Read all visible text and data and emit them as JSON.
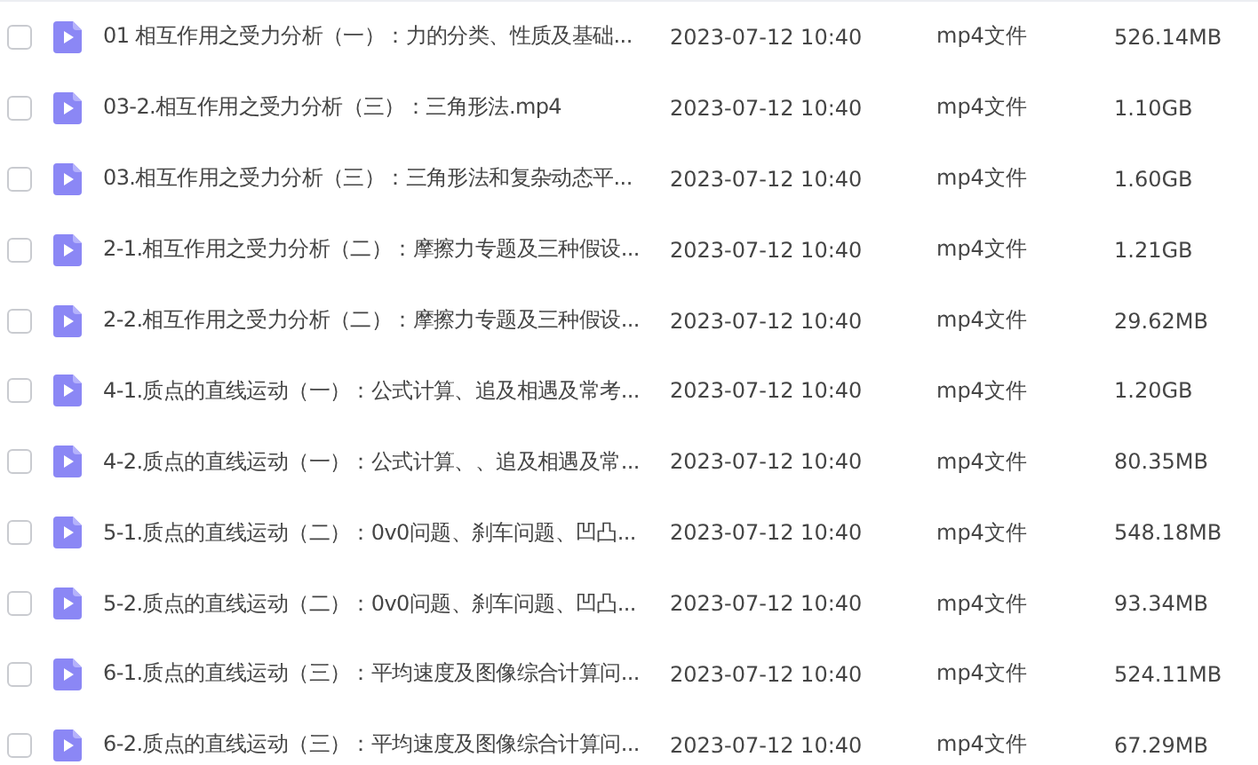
{
  "files": [
    {
      "checked": false,
      "name": "01 相互作用之受力分析（一）：力的分类、性质及基础...",
      "date": "2023-07-12 10:40",
      "type": "mp4文件",
      "size": "526.14MB"
    },
    {
      "checked": false,
      "name": "03-2.相互作用之受力分析（三）：三角形法.mp4",
      "date": "2023-07-12 10:40",
      "type": "mp4文件",
      "size": "1.10GB"
    },
    {
      "checked": false,
      "name": "03.相互作用之受力分析（三）：三角形法和复杂动态平...",
      "date": "2023-07-12 10:40",
      "type": "mp4文件",
      "size": "1.60GB"
    },
    {
      "checked": false,
      "name": "2-1.相互作用之受力分析（二）：摩擦力专题及三种假设...",
      "date": "2023-07-12 10:40",
      "type": "mp4文件",
      "size": "1.21GB"
    },
    {
      "checked": false,
      "name": "2-2.相互作用之受力分析（二）：摩擦力专题及三种假设...",
      "date": "2023-07-12 10:40",
      "type": "mp4文件",
      "size": "29.62MB"
    },
    {
      "checked": false,
      "name": "4-1.质点的直线运动（一）：公式计算、追及相遇及常考...",
      "date": "2023-07-12 10:40",
      "type": "mp4文件",
      "size": "1.20GB"
    },
    {
      "checked": false,
      "name": "4-2.质点的直线运动（一）：公式计算、、追及相遇及常...",
      "date": "2023-07-12 10:40",
      "type": "mp4文件",
      "size": "80.35MB"
    },
    {
      "checked": false,
      "name": "5-1.质点的直线运动（二）：0v0问题、刹车问题、凹凸...",
      "date": "2023-07-12 10:40",
      "type": "mp4文件",
      "size": "548.18MB"
    },
    {
      "checked": false,
      "name": "5-2.质点的直线运动（二）：0v0问题、刹车问题、凹凸...",
      "date": "2023-07-12 10:40",
      "type": "mp4文件",
      "size": "93.34MB"
    },
    {
      "checked": false,
      "name": "6-1.质点的直线运动（三）：平均速度及图像综合计算问...",
      "date": "2023-07-12 10:40",
      "type": "mp4文件",
      "size": "524.11MB"
    },
    {
      "checked": false,
      "name": "6-2.质点的直线运动（三）：平均速度及图像综合计算问...",
      "date": "2023-07-12 10:40",
      "type": "mp4文件",
      "size": "67.29MB"
    }
  ]
}
